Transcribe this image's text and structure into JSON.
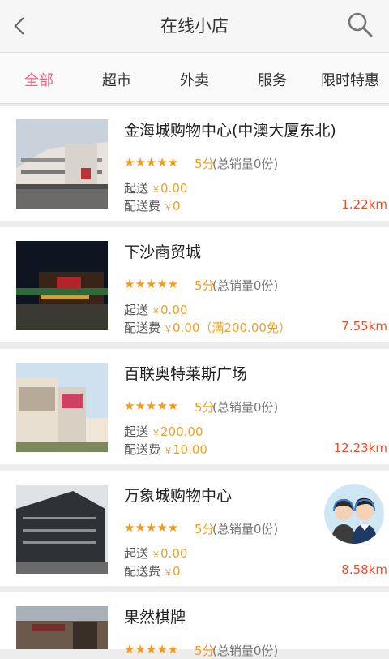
{
  "header": {
    "title": "在线小店",
    "back_icon": "chevron-left-icon",
    "search_icon": "search-icon"
  },
  "tabs": [
    {
      "label": "全部",
      "active": true
    },
    {
      "label": "超市",
      "active": false
    },
    {
      "label": "外卖",
      "active": false
    },
    {
      "label": "服务",
      "active": false
    },
    {
      "label": "限时特惠",
      "active": false
    }
  ],
  "labels": {
    "min_order": "起送",
    "delivery_fee": "配送费",
    "currency": "￥"
  },
  "stores": [
    {
      "name": "金海城购物中心(中澳大厦东北)",
      "stars": "★★★★★",
      "rating": "5分",
      "sales": "(总销量0份)",
      "min_order": "0.00",
      "fee": "0",
      "distance": "1.22km"
    },
    {
      "name": "下沙商贸城",
      "stars": "★★★★★",
      "rating": "5分",
      "sales": "(总销量0份)",
      "min_order": "0.00",
      "fee": "0.00（满200.00免）",
      "distance": "7.55km"
    },
    {
      "name": "百联奥特莱斯广场",
      "stars": "★★★★★",
      "rating": "5分",
      "sales": "(总销量0份)",
      "min_order": "200.00",
      "fee": "10.00",
      "distance": "12.23km"
    },
    {
      "name": "万象城购物中心",
      "stars": "★★★★★",
      "rating": "5分",
      "sales": "(总销量0份)",
      "min_order": "0.00",
      "fee": "0",
      "distance": "8.58km"
    },
    {
      "name": "果然棋牌",
      "stars": "★★★★★",
      "rating": "5分",
      "sales": "(总销量0份)",
      "min_order": "",
      "fee": "",
      "distance": ""
    }
  ],
  "colors": {
    "accent": "#f0607a",
    "star": "#f39a1f",
    "distance": "#e8502a",
    "price": "#f0a020"
  }
}
